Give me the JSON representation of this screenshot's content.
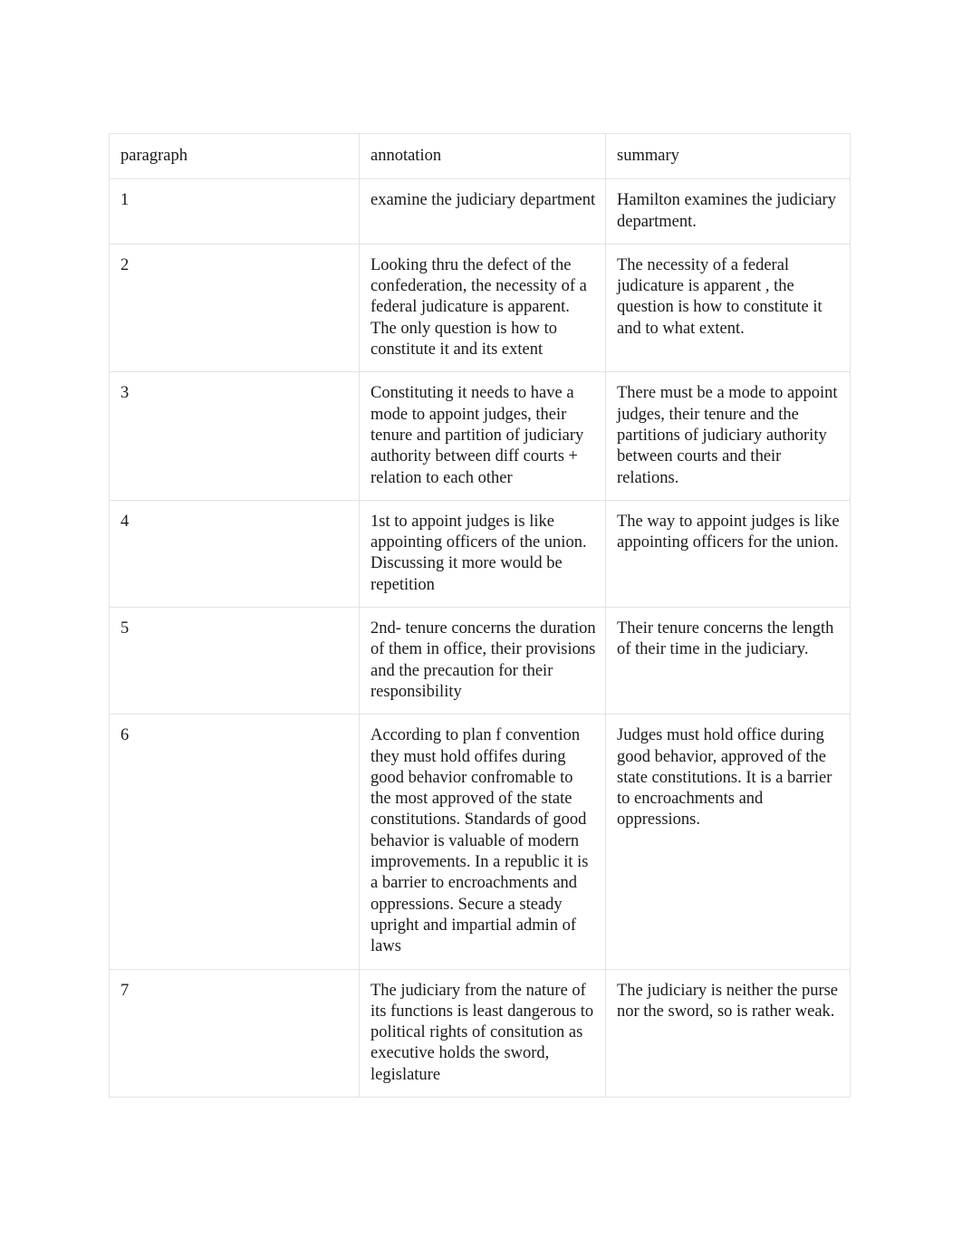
{
  "document": {
    "type": "annotation-summary-table",
    "page_background": "#ffffff",
    "border_color": "#e3e3e3",
    "text_color": "#1a1a1a"
  },
  "table": {
    "headers": {
      "paragraph": "paragraph",
      "annotation": "annotation",
      "summary": "summary"
    },
    "rows": [
      {
        "paragraph": "1",
        "annotation": "examine the judiciary department",
        "summary": "Hamilton examines the judiciary department."
      },
      {
        "paragraph": "2",
        "annotation": "Looking thru the defect of the confederation, the necessity of a federal judicature is apparent. The only question is how to constitute it and its extent",
        "summary": "The necessity of a federal judicature is apparent , the question is how to constitute it and to what extent."
      },
      {
        "paragraph": "3",
        "annotation": "Constituting it needs to have a mode to appoint judges, their tenure and partition of judiciary authority between diff courts + relation to each other",
        "summary": "There must be a mode to appoint judges, their tenure and the partitions of judiciary authority between courts and their relations."
      },
      {
        "paragraph": "4",
        "annotation": "1st to appoint judges is like appointing officers of the union. Discussing it more would be repetition",
        "summary": "The way to appoint judges is like appointing officers for the union."
      },
      {
        "paragraph": "5",
        "annotation": "2nd- tenure concerns the duration of them in office, their provisions and the precaution for their responsibility",
        "summary": "Their tenure concerns the length of their time in the judiciary."
      },
      {
        "paragraph": "6",
        "annotation": "According to plan f convention they must hold offifes during good behavior confromable to the most approved of the state constitutions. Standards of good behavior is valuable of modern improvements. In a republic it is a barrier to encroachments and oppressions. Secure a steady upright and impartial admin of laws",
        "summary": "Judges must hold office during good behavior, approved of the state constitutions. It is a barrier to encroachments and oppressions."
      },
      {
        "paragraph": "7",
        "annotation": "The judiciary from the nature of its functions is least dangerous to political rights of consitution as executive holds the sword, legislature",
        "summary": "The judiciary is neither the purse nor the sword, so is rather weak."
      }
    ]
  }
}
